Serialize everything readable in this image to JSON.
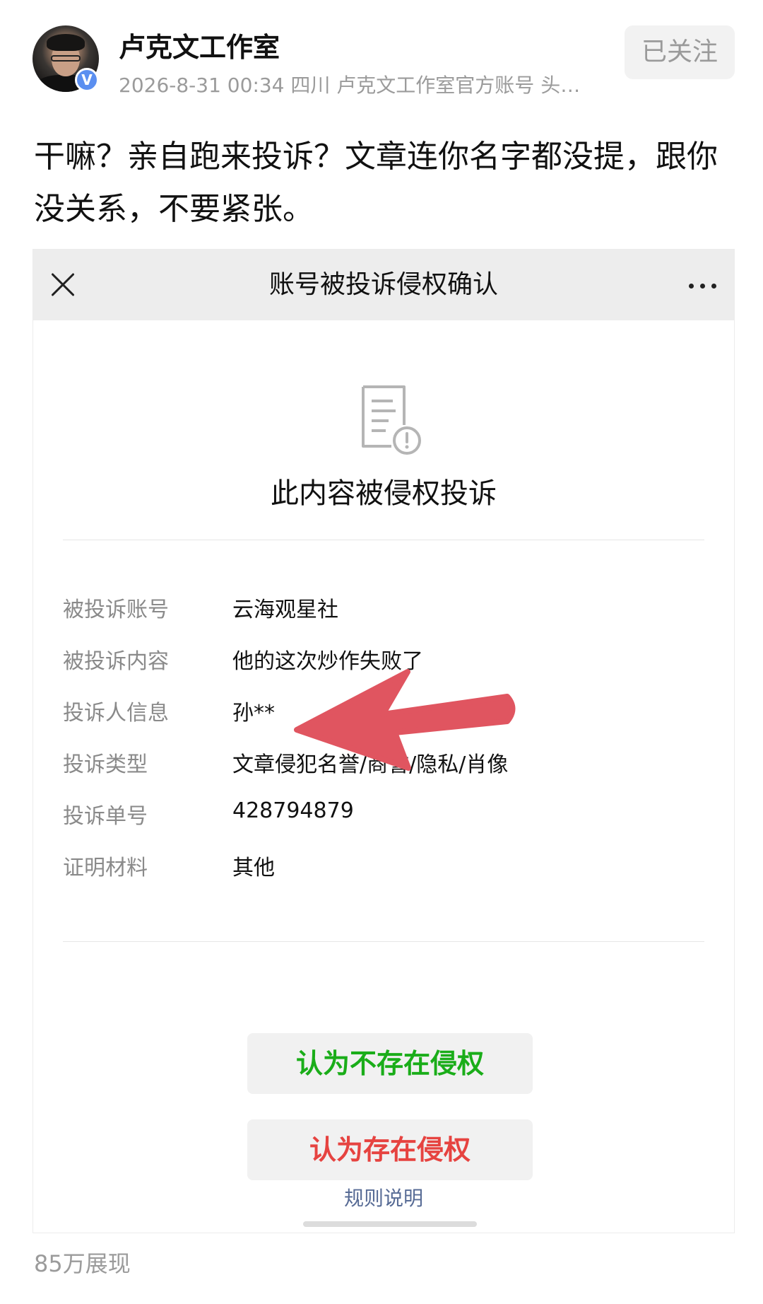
{
  "post_header": {
    "author": "卢克文工作室",
    "verified_badge": "V",
    "meta": "2026-8-31 00:34 四川 卢克文工作室官方账号 头…",
    "follow_label": "已关注"
  },
  "post_text": "干嘛？亲自跑来投诉？文章连你名字都没提，跟你没关系，不要紧张。",
  "screenshot": {
    "title": "账号被投诉侵权确认",
    "heading": "此内容被侵权投诉",
    "details": [
      {
        "label": "被投诉账号",
        "value": "云海观星社"
      },
      {
        "label": "被投诉内容",
        "value": "他的这次炒作失败了"
      },
      {
        "label": "投诉人信息",
        "value": "孙**"
      },
      {
        "label": "投诉类型",
        "value": "文章侵犯名誉/商誉/隐私/肖像"
      },
      {
        "label": "投诉单号",
        "value": "428794879"
      },
      {
        "label": "证明材料",
        "value": "其他"
      }
    ],
    "btn_not_infringe": "认为不存在侵权",
    "btn_infringe": "认为存在侵权",
    "rules_link": "规则说明"
  },
  "footer": {
    "views": "85万展现"
  },
  "colors": {
    "accept_green": "#1aad19",
    "reject_red": "#e64340",
    "link_blue": "#576b95",
    "arrow_red": "#e05560",
    "verified_blue": "#5b8ff0"
  },
  "icons": [
    "close-icon",
    "more-icon",
    "document-warning-icon",
    "verified-badge-icon",
    "red-arrow-annotation"
  ]
}
